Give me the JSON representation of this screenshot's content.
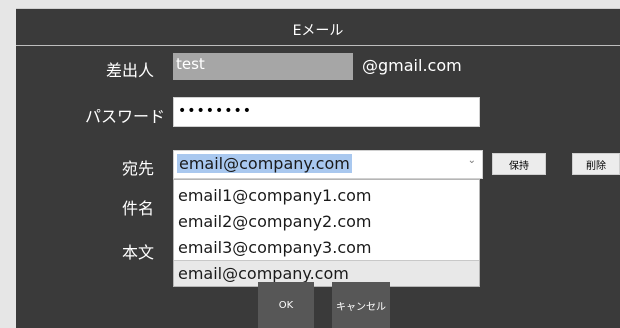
{
  "window": {
    "title": "Eメール"
  },
  "form": {
    "sender_label": "差出人",
    "sender_value": "test",
    "sender_domain": "@gmail.com",
    "password_label": "パスワード",
    "password_value": "••••••••",
    "to_label": "宛先",
    "to_value": "email@company.com",
    "subject_label": "件名",
    "body_label": "本文"
  },
  "to_actions": {
    "keep_label": "保持",
    "delete_label": "削除"
  },
  "to_dropdown": {
    "options": [
      "email1@company1.com",
      "email2@company2.com",
      "email3@company3.com",
      "email@company.com"
    ],
    "selected_index": 3
  },
  "footer": {
    "ok_label": "OK",
    "cancel_label": "キャンセル"
  },
  "colors": {
    "window_bg": "#3a3a3a",
    "selection_highlight": "#a9c8ef",
    "disabled_field": "#a6a6a6"
  },
  "icons": {
    "dropdown_arrow": "chevron-down-icon"
  }
}
